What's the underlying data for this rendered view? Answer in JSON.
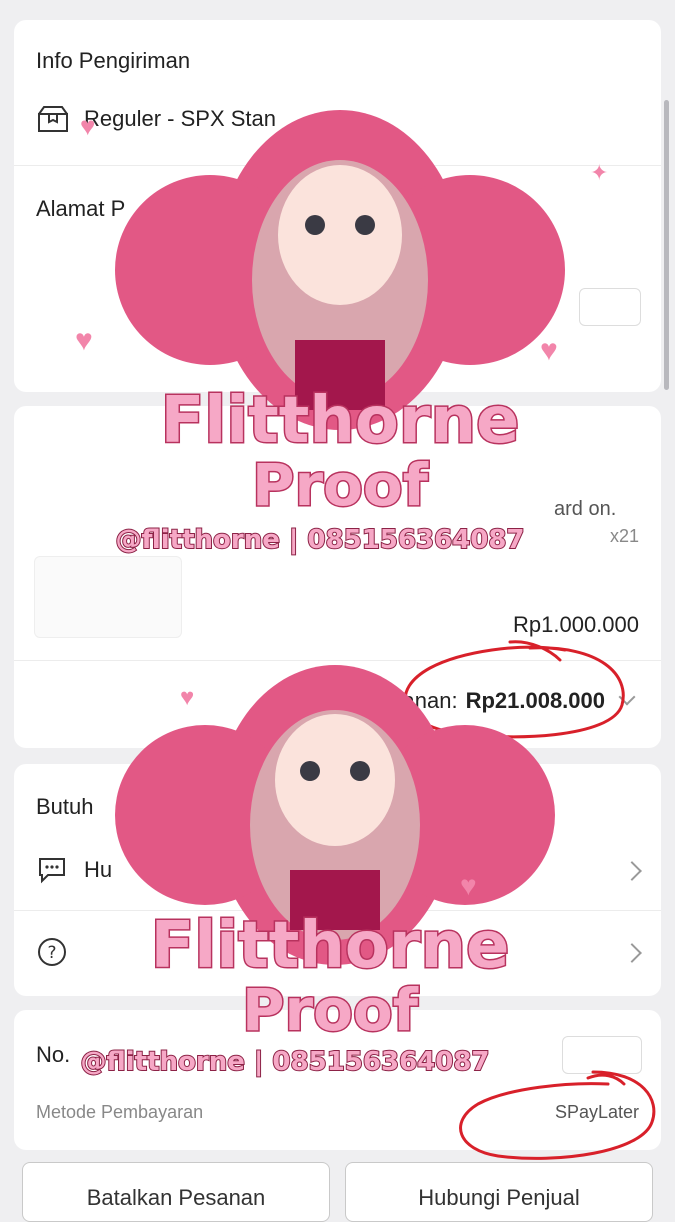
{
  "shipping": {
    "title": "Info Pengiriman",
    "service": "Reguler - SPX Stan",
    "address_title": "Alamat P"
  },
  "product": {
    "qty": "x21",
    "partial_name": "ard on.",
    "price": "Rp1.000.000",
    "total_label": "Pesanan:",
    "total_value": "Rp21.008.000"
  },
  "help": {
    "title": "Butuh",
    "chat_label": "Hu",
    "faq_icon": "question-circle-icon"
  },
  "order": {
    "no_label": "No.",
    "payment_label": "Metode Pembayaran",
    "payment_value": "SPayLater"
  },
  "footer": {
    "cancel_label": "Batalkan Pesanan",
    "contact_label": "Hubungi Penjual"
  },
  "watermark": {
    "name_line1": "Flitthorne",
    "name_line2": "Proof",
    "handle": "@flitthorne | 085156364087"
  },
  "colors": {
    "annotation_red": "#d8202a",
    "watermark_pink": "#f6a8c6",
    "watermark_outline": "#b8325e"
  }
}
